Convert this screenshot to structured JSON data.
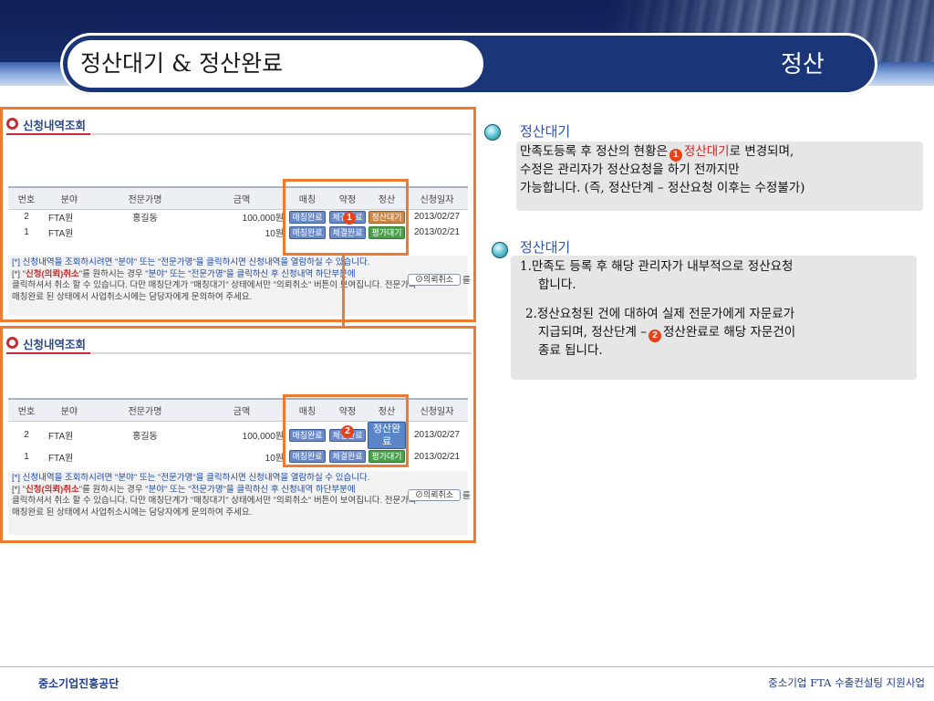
{
  "header": {
    "title": "정산대기 & 정산완료",
    "section": "정산"
  },
  "panels": [
    {
      "heading": "신청내역조회",
      "columns": [
        "번호",
        "분야",
        "전문가명",
        "금액",
        "매칭",
        "약정",
        "정산",
        "신청일자"
      ],
      "rows": [
        {
          "no": "2",
          "field": "FTA원",
          "expert": "홍길동",
          "amount": "100,000원",
          "matching": "매칭완료",
          "agreement": "체결완료",
          "settlement": "정산대기",
          "date": "2013/02/27"
        },
        {
          "no": "1",
          "field": "FTA원",
          "expert": "",
          "amount": "10원",
          "matching": "매칭완료",
          "agreement": "체결완료",
          "settlement": "평가대기",
          "date": "2013/02/21"
        }
      ],
      "note1": "[*] 신청내역을 조회하시려면 \"분야\" 또는 \"전문가명\"을 클릭하시면 신청내역을 열람하실 수 있습니다.",
      "note2a": "[*] \"",
      "note2b": "신청(의뢰)취소",
      "note2c": "\"를 원하시는 경우 ",
      "note2d": "\"분야\" 또는 \"전문가명\"을 클릭하신 후 신청내역 하단부분에",
      "note2e": "를",
      "note3": "클릭하셔서 취소 할 수 있습니다. 다만 매칭단계가 \"매칭대기\" 상태에서만 \"의뢰취소\" 버튼이 보여집니다. 전문가와",
      "note4": "매칭완료 된 상태에서 사업취소시에는 담당자에게 문의하여 주세요.",
      "cancel_button": "⊘의뢰취소",
      "step_marker": "1"
    },
    {
      "heading": "신청내역조회",
      "columns": [
        "번호",
        "분야",
        "전문가명",
        "금액",
        "매칭",
        "약정",
        "정산",
        "신청일자"
      ],
      "rows": [
        {
          "no": "2",
          "field": "FTA원",
          "expert": "홍길동",
          "amount": "100,000원",
          "matching": "매칭완료",
          "agreement": "체결완료",
          "settlement": "정산완료",
          "date": "2013/02/27"
        },
        {
          "no": "1",
          "field": "FTA원",
          "expert": "",
          "amount": "10원",
          "matching": "매칭완료",
          "agreement": "체결완료",
          "settlement": "평가대기",
          "date": "2013/02/21"
        }
      ],
      "note1": "[*] 신청내역을 조회하시려면 \"분야\" 또는 \"전문가명\"을 클릭하시면 신청내역을 열람하실 수 있습니다.",
      "note2a": "[*] \"",
      "note2b": "신청(의뢰)취소",
      "note2c": "\"를 원하시는 경우 ",
      "note2d": "\"분야\" 또는 \"전문가명\"을 클릭하신 후 신청내역 하단부분에",
      "note2e": "를",
      "note3": "클릭하셔서 취소 할 수 있습니다. 다만 매칭단계가 \"매칭대기\" 상태에서만 \"의뢰취소\" 버튼이 보여집니다. 전문가와",
      "note4": "매칭완료 된 상태에서 사업취소시에는 담당자에게 문의하여 주세요.",
      "cancel_button": "⊘의뢰취소",
      "step_marker": "2"
    }
  ],
  "explanations": [
    {
      "title": "정산대기",
      "line1a": "만족도등록 후 정산의 현황은",
      "marker": "1",
      "line1b": "정산대기",
      "line1c": "로 변경되며,",
      "line2": "수정은 관리자가 정산요청을 하기 전까지만",
      "line3": "가능합니다. (즉, 정산단계 – 정산요청 이후는 수정불가)"
    },
    {
      "title": "정산대기",
      "line1": "1.만족도 등록 후 해당 관리자가 내부적으로 정산요청",
      "line2": "합니다.",
      "line3": "2.정산요청된 건에 대하여 실제 전문가에게 자문료가",
      "line4a": "지급되며, 정산단계 –",
      "marker": "2",
      "line4b": "정산완료로 해당 자문건이",
      "line5": "종료 됩니다."
    }
  ],
  "footer": {
    "left": "중소기업진흥공단",
    "right": "중소기업 FTA 수출컨설팅 지원사업"
  }
}
